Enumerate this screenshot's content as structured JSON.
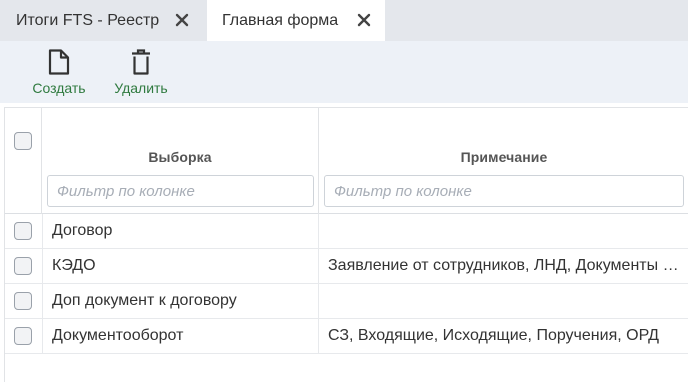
{
  "tabs": [
    {
      "label": "Итоги FTS - Реестр"
    },
    {
      "label": "Главная форма"
    }
  ],
  "toolbar": {
    "create_label": "Создать",
    "delete_label": "Удалить"
  },
  "table": {
    "columns": [
      {
        "header": "Выборка",
        "filter_placeholder": "Фильтр по колонке"
      },
      {
        "header": "Примечание",
        "filter_placeholder": "Фильтр по колонке"
      }
    ],
    "rows": [
      {
        "name": "Договор",
        "note": ""
      },
      {
        "name": "КЭДО",
        "note": "Заявление от сотрудников, ЛНД, Документы по ОТ"
      },
      {
        "name": "Доп документ к договору",
        "note": ""
      },
      {
        "name": "Документооборот",
        "note": "СЗ, Входящие, Исходящие, Поручения, ОРД"
      }
    ]
  },
  "colors": {
    "accent": "#2f7a3f",
    "tabbar": "#e4e7ec",
    "toolbar": "#edf1f7"
  }
}
